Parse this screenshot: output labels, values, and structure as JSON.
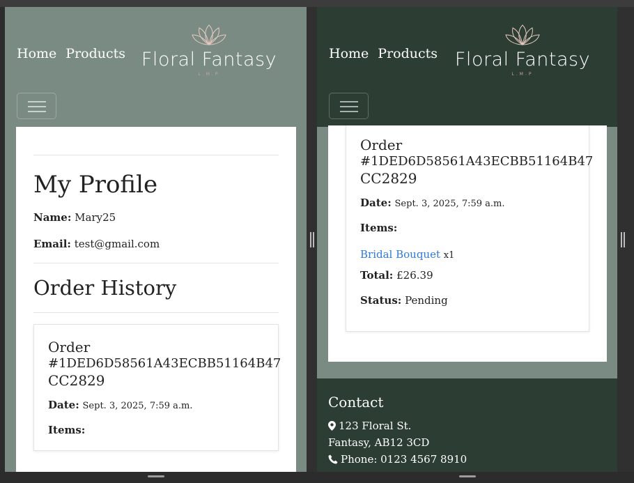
{
  "nav": {
    "home": "Home",
    "products": "Products",
    "brand_name": "Floral Fantasy",
    "brand_sub": "L.M.P"
  },
  "profile": {
    "title": "My Profile",
    "name_label": "Name:",
    "name_value": "Mary25",
    "email_label": "Email:",
    "email_value": "test@gmail.com",
    "history_title": "Order History"
  },
  "order": {
    "title_line1": "Order",
    "title_line2": "#1DED6D58561A43ECBB51164B47",
    "title_line3": "CC2829",
    "date_label": "Date:",
    "date_value": "Sept. 3, 2025, 7:59 a.m.",
    "items_label": "Items:",
    "item_name": "Bridal Bouquet",
    "item_qty": "x1",
    "total_label": "Total:",
    "total_value": "£26.39",
    "status_label": "Status:",
    "status_value": "Pending"
  },
  "footer": {
    "title": "Contact",
    "address_line1": "123 Floral St.",
    "address_line2": "Fantasy, AB12 3CD",
    "phone": "Phone: 0123 4567 8910"
  },
  "colors": {
    "sage": "#7a8b84",
    "forest": "#2c3e34",
    "link": "#2e7ad9",
    "rose_gold": "#c9a79d"
  }
}
